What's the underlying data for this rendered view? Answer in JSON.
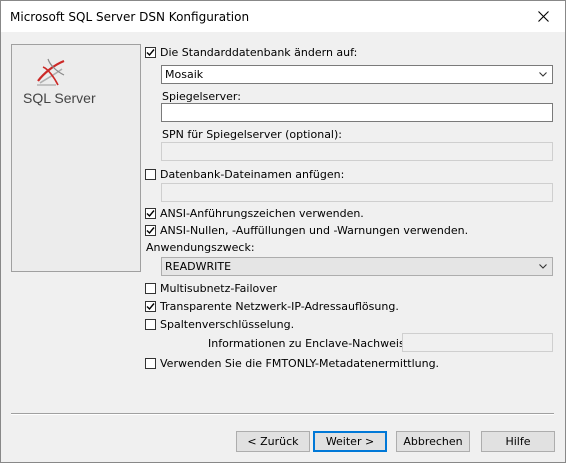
{
  "window": {
    "title": "Microsoft SQL Server DSN Konfiguration"
  },
  "logo": {
    "text": "SQL Server",
    "icon": "sql-server-logo-icon"
  },
  "form": {
    "change_default_db": {
      "label": "Die Standarddatenbank ändern auf:",
      "checked": true
    },
    "database": {
      "value": "Mosaik"
    },
    "mirror_server": {
      "label": "Spiegelserver:",
      "value": ""
    },
    "mirror_spn": {
      "label": "SPN für Spiegelserver (optional):",
      "value": ""
    },
    "attach_db_filename": {
      "label": "Datenbank-Dateinamen anfügen:",
      "checked": false,
      "value": ""
    },
    "ansi_quotes": {
      "label": "ANSI-Anführungszeichen verwenden.",
      "checked": true
    },
    "ansi_nulls": {
      "label": "ANSI-Nullen, -Auffüllungen und -Warnungen verwenden.",
      "checked": true
    },
    "application_intent": {
      "label": "Anwendungszweck:",
      "value": "READWRITE"
    },
    "multisubnet_failover": {
      "label": "Multisubnetz-Failover",
      "checked": false
    },
    "transparent_ip": {
      "label": "Transparente Netzwerk-IP-Adressauflösung.",
      "checked": true
    },
    "column_encryption": {
      "label": "Spaltenverschlüsselung.",
      "checked": false
    },
    "enclave_attestation": {
      "label": "Informationen zu Enclave-Nachweis:",
      "value": ""
    },
    "fmtonly": {
      "label": "Verwenden Sie die FMTONLY-Metadatenermittlung.",
      "checked": false
    }
  },
  "buttons": {
    "back": "< Zurück",
    "next": "Weiter >",
    "cancel": "Abbrechen",
    "help": "Hilfe"
  },
  "colors": {
    "accent": "#0078d7",
    "logo_red": "#cc2927"
  }
}
